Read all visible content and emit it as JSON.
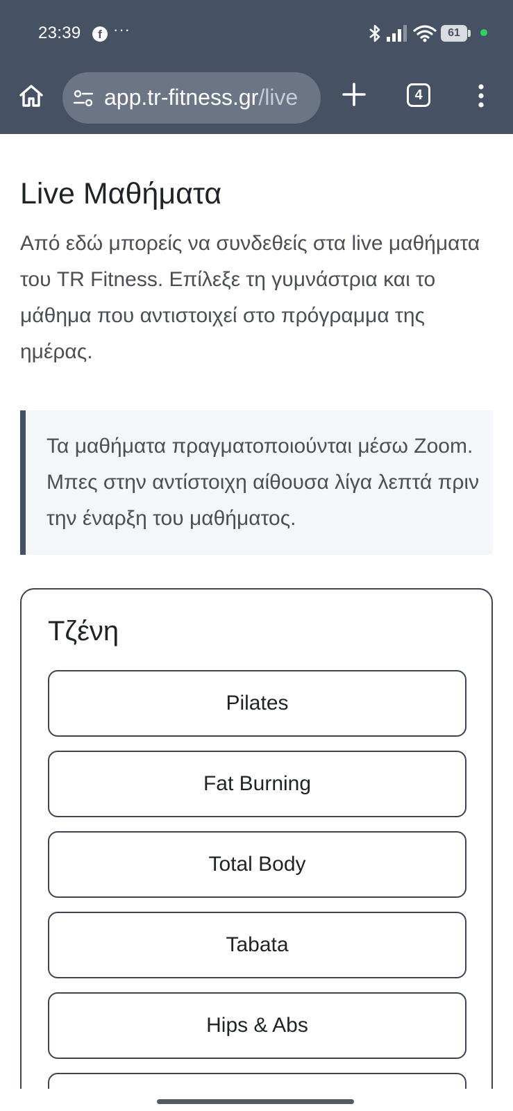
{
  "status_bar": {
    "time": "23:39",
    "notification_icon": "facebook-icon",
    "overflow": "···",
    "battery_level": "61",
    "icons": [
      "bluetooth-icon",
      "signal-icon",
      "wifi-icon",
      "battery-icon",
      "privacy-dot-icon"
    ]
  },
  "browser": {
    "url_host": "app.tr-fitness.gr",
    "url_path": "/live",
    "tab_count": "4",
    "icons": [
      "home-icon",
      "site-info-icon",
      "new-tab-icon",
      "tab-switcher-icon",
      "menu-icon"
    ]
  },
  "page": {
    "title": "Live Μαθήματα",
    "intro": "Από εδώ μπορείς να συνδεθείς στα live μαθήματα του TR Fitness. Επίλεξε τη γυμνάστρια και το μάθημα που αντιστοιχεί στο πρόγραμμα της ημέρας.",
    "notice": "Τα μαθήματα πραγματοποιούνται μέσω Zoom. Μπες στην αντίστοιχη αίθουσα λίγα λεπτά πριν την έναρξη του μαθήματος."
  },
  "gym": {
    "name": "Τζένη",
    "classes": [
      "Pilates",
      "Fat Burning",
      "Total Body",
      "Tabata",
      "Hips & Abs"
    ]
  },
  "colors": {
    "chrome": "#465163",
    "urlbar": "#6b7585",
    "accent_border": "#465163",
    "notice_bg": "#f4f6f9",
    "text": "#1f2328",
    "muted_text": "#4b4f55"
  }
}
